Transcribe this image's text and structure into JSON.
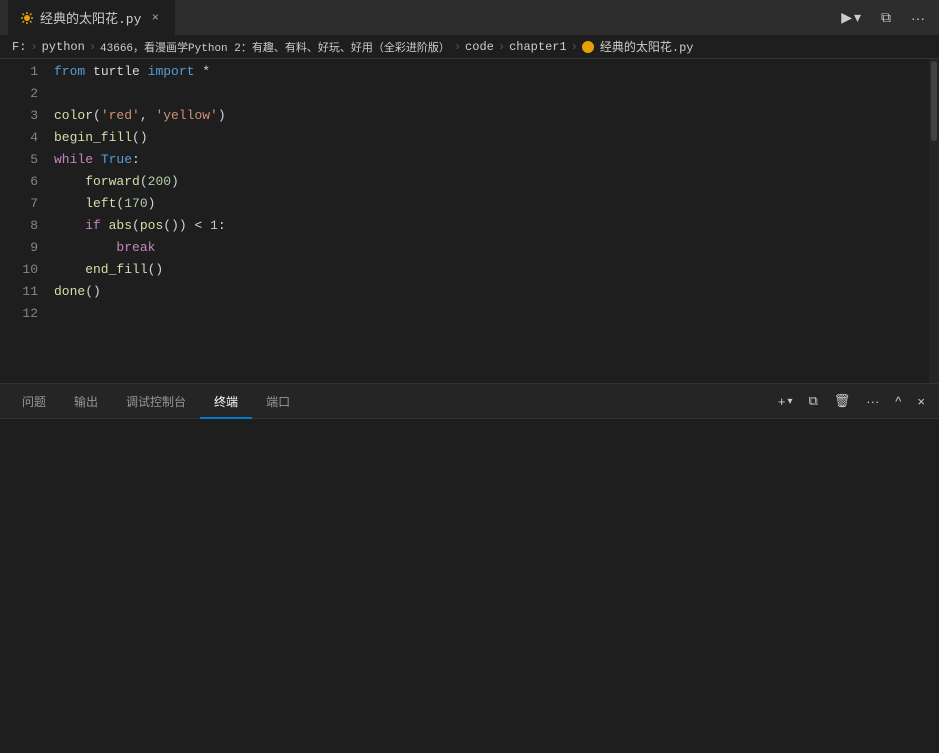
{
  "titleBar": {
    "tab": {
      "label": "经典的太阳花.py",
      "closeBtn": "×"
    },
    "runBtn": "▶",
    "runChevron": "▾",
    "splitBtn": "⧉",
    "moreBtn": "···"
  },
  "breadcrumb": {
    "items": [
      "F:",
      "python",
      "43666，看漫画学Python 2：有趣、有料、好玩、好用（全彩进阶版）",
      "code",
      "chapter1",
      "经典的太阳花.py"
    ]
  },
  "editor": {
    "lines": [
      {
        "num": 1,
        "tokens": [
          {
            "text": "from",
            "cls": "kw-from"
          },
          {
            "text": " turtle ",
            "cls": ""
          },
          {
            "text": "import",
            "cls": "kw-import"
          },
          {
            "text": " *",
            "cls": "op"
          }
        ]
      },
      {
        "num": 2,
        "tokens": []
      },
      {
        "num": 3,
        "tokens": [
          {
            "text": "color",
            "cls": "fn-call"
          },
          {
            "text": "(",
            "cls": "paren"
          },
          {
            "text": "'red'",
            "cls": "str-red"
          },
          {
            "text": ", ",
            "cls": ""
          },
          {
            "text": "'yellow'",
            "cls": "str-yellow"
          },
          {
            "text": ")",
            "cls": "paren"
          }
        ]
      },
      {
        "num": 4,
        "tokens": [
          {
            "text": "begin_fill",
            "cls": "fn-call"
          },
          {
            "text": "()",
            "cls": "paren"
          }
        ]
      },
      {
        "num": 5,
        "tokens": [
          {
            "text": "while",
            "cls": "kw-while"
          },
          {
            "text": " ",
            "cls": ""
          },
          {
            "text": "True",
            "cls": "kw-true"
          },
          {
            "text": ":",
            "cls": ""
          }
        ]
      },
      {
        "num": 6,
        "tokens": [
          {
            "text": "    forward",
            "cls": "fn-call"
          },
          {
            "text": "(",
            "cls": "paren"
          },
          {
            "text": "200",
            "cls": "num"
          },
          {
            "text": ")",
            "cls": "paren"
          }
        ]
      },
      {
        "num": 7,
        "tokens": [
          {
            "text": "    left",
            "cls": "fn-call"
          },
          {
            "text": "(",
            "cls": "paren"
          },
          {
            "text": "170",
            "cls": "num"
          },
          {
            "text": ")",
            "cls": "paren"
          }
        ]
      },
      {
        "num": 8,
        "tokens": [
          {
            "text": "    ",
            "cls": ""
          },
          {
            "text": "if",
            "cls": "kw-if"
          },
          {
            "text": " abs",
            "cls": "fn-call"
          },
          {
            "text": "(",
            "cls": "paren"
          },
          {
            "text": "pos",
            "cls": "fn-call"
          },
          {
            "text": "()",
            "cls": "paren"
          },
          {
            "text": ")",
            "cls": "paren"
          },
          {
            "text": " < ",
            "cls": "op"
          },
          {
            "text": "1",
            "cls": "num"
          },
          {
            "text": ":",
            "cls": ""
          }
        ]
      },
      {
        "num": 9,
        "tokens": [
          {
            "text": "        ",
            "cls": ""
          },
          {
            "text": "break",
            "cls": "kw-break"
          }
        ]
      },
      {
        "num": 10,
        "tokens": [
          {
            "text": "    end_fill",
            "cls": "fn-call"
          },
          {
            "text": "()",
            "cls": "paren"
          }
        ]
      },
      {
        "num": 11,
        "tokens": [
          {
            "text": "done",
            "cls": "fn-call"
          },
          {
            "text": "()",
            "cls": "paren"
          }
        ]
      },
      {
        "num": 12,
        "tokens": []
      }
    ]
  },
  "panel": {
    "tabs": [
      {
        "label": "问题",
        "active": false
      },
      {
        "label": "输出",
        "active": false
      },
      {
        "label": "调试控制台",
        "active": false
      },
      {
        "label": "终端",
        "active": true
      },
      {
        "label": "端口",
        "active": false
      }
    ],
    "actions": {
      "add": "+",
      "addChevron": "▾",
      "split": "⧉",
      "trash": "🗑",
      "more": "···",
      "up": "^",
      "close": "×"
    }
  }
}
